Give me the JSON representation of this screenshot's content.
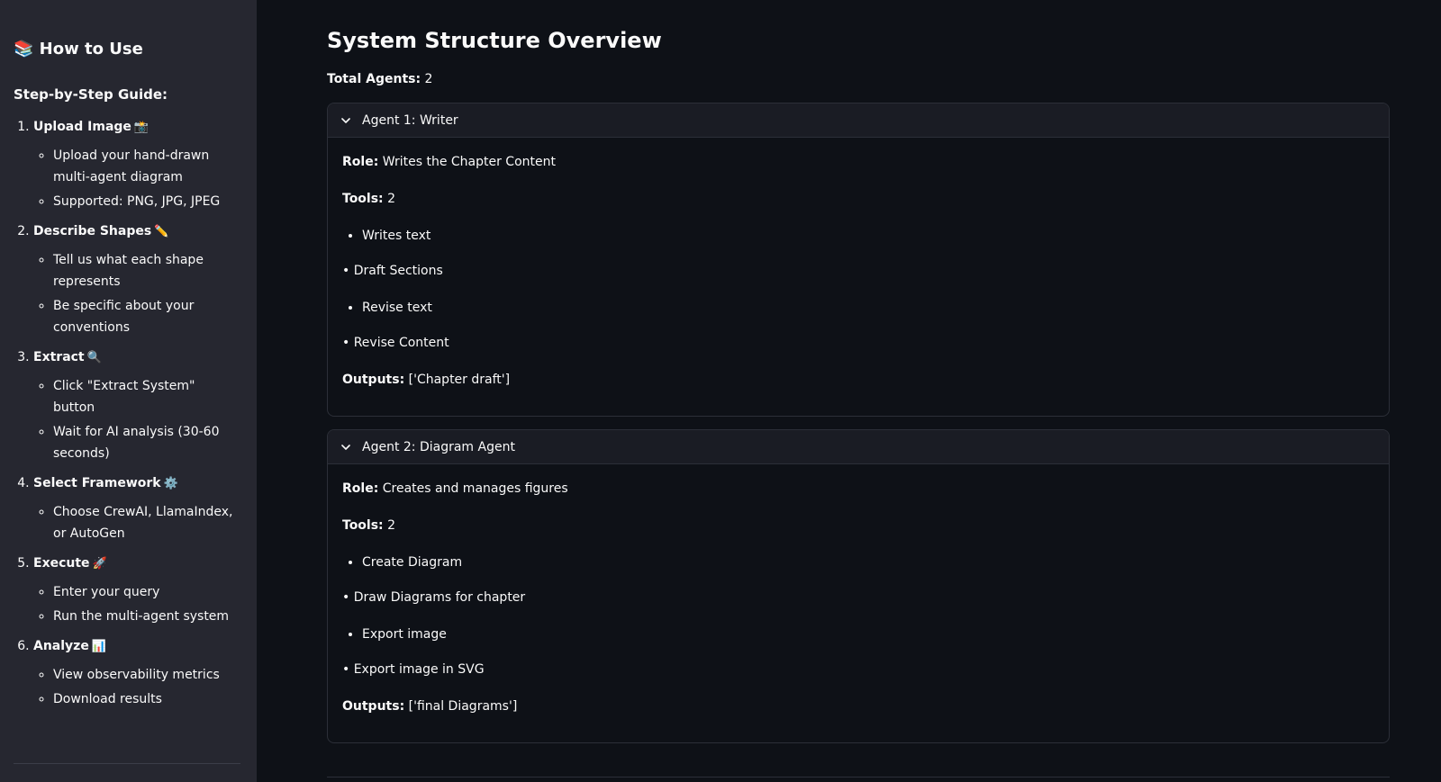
{
  "sidebar": {
    "title": "📚 How to Use",
    "subtitle": "Step-by-Step Guide:",
    "steps": [
      {
        "label": "Upload Image",
        "emoji": "📸",
        "items": [
          "Upload your hand-drawn multi-agent diagram",
          "Supported: PNG, JPG, JPEG"
        ]
      },
      {
        "label": "Describe Shapes",
        "emoji": "✏️",
        "items": [
          "Tell us what each shape represents",
          "Be specific about your conventions"
        ]
      },
      {
        "label": "Extract",
        "emoji": "🔍",
        "items": [
          "Click \"Extract System\" button",
          "Wait for AI analysis (30-60 seconds)"
        ]
      },
      {
        "label": "Select Framework",
        "emoji": "⚙️",
        "items": [
          "Choose CrewAI, LlamaIndex, or AutoGen"
        ]
      },
      {
        "label": "Execute",
        "emoji": "🚀",
        "items": [
          "Enter your query",
          "Run the multi-agent system"
        ]
      },
      {
        "label": "Analyze",
        "emoji": "📊",
        "items": [
          "View observability metrics",
          "Download results"
        ]
      }
    ]
  },
  "main": {
    "title": "System Structure Overview",
    "total_label": "Total Agents:",
    "total_value": "2",
    "agents": [
      {
        "header": "Agent 1: Writer",
        "role_label": "Role:",
        "role": "Writes the Chapter Content",
        "tools_label": "Tools:",
        "tools_count": "2",
        "tool1_name": "Writes text",
        "tool1_desc": "• Draft Sections",
        "tool2_name": "Revise text",
        "tool2_desc": "• Revise Content",
        "outputs_label": "Outputs:",
        "outputs": "['Chapter draft']"
      },
      {
        "header": "Agent 2: Diagram Agent",
        "role_label": "Role:",
        "role": "Creates and manages figures",
        "tools_label": "Tools:",
        "tools_count": "2",
        "tool1_name": "Create Diagram",
        "tool1_desc": "• Draw Diagrams for chapter",
        "tool2_name": "Export image",
        "tool2_desc": "• Export image in SVG",
        "outputs_label": "Outputs:",
        "outputs": "['final Diagrams']"
      }
    ]
  }
}
